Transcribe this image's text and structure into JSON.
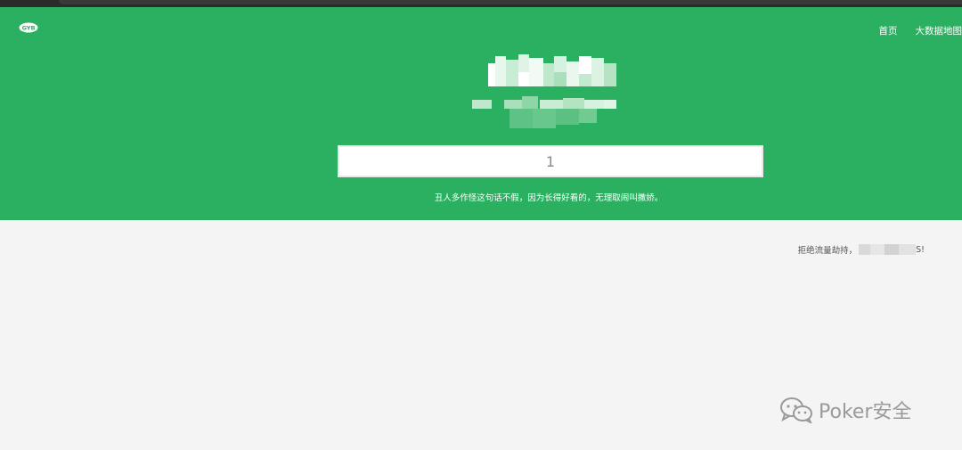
{
  "header": {
    "logo_text": "GYB",
    "nav": [
      {
        "label": "首页"
      },
      {
        "label": "大数据地图"
      }
    ]
  },
  "search": {
    "value": "1",
    "placeholder": ""
  },
  "tagline": "丑人多作怪这句话不假，因为长得好看的，无理取闹叫撒娇。",
  "notice": {
    "prefix": "拒绝流量劫持，",
    "suffix": "S!"
  },
  "watermark": {
    "text": "Poker安全"
  },
  "colors": {
    "hero_green": "#2bb061",
    "page_bg": "#f4f4f4"
  }
}
